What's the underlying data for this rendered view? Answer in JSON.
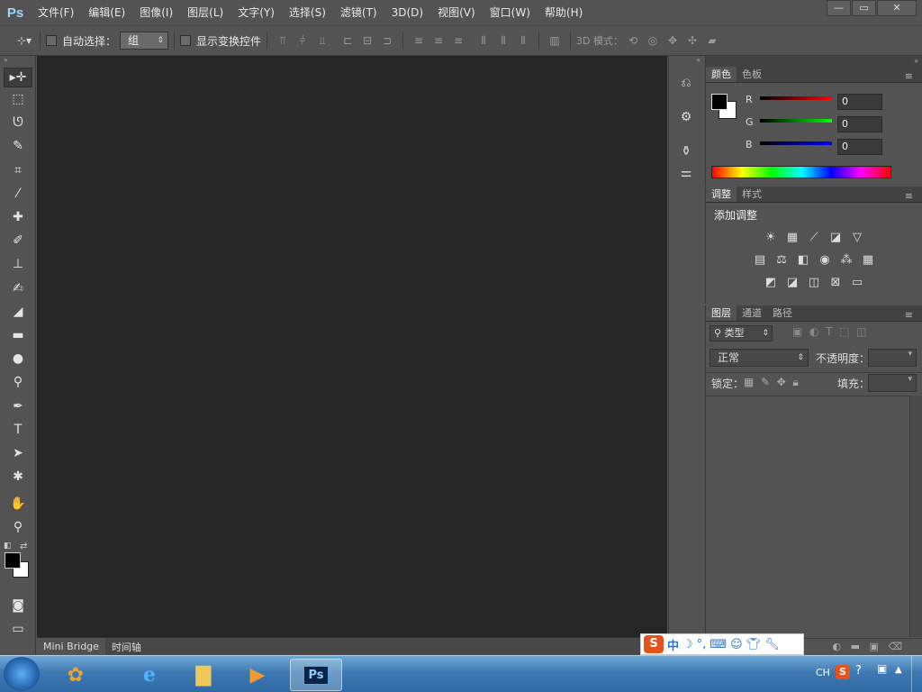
{
  "app": {
    "logo": "Ps"
  },
  "menu": [
    "文件(F)",
    "编辑(E)",
    "图像(I)",
    "图层(L)",
    "文字(Y)",
    "选择(S)",
    "滤镜(T)",
    "3D(D)",
    "视图(V)",
    "窗口(W)",
    "帮助(H)"
  ],
  "window_buttons": {
    "minimize": "—",
    "restore": "▭",
    "close": "✕"
  },
  "options_bar": {
    "auto_select_label": "自动选择：",
    "auto_select_value": "组",
    "show_transform_label": "显示变换控件",
    "mode_3d_label": "3D 模式："
  },
  "tools": [
    "move-tool",
    "marquee-tool",
    "lasso-tool",
    "quick-select-tool",
    "crop-tool",
    "eyedropper-tool",
    "healing-brush-tool",
    "brush-tool",
    "clone-stamp-tool",
    "history-brush-tool",
    "eraser-tool",
    "gradient-tool",
    "blur-tool",
    "dodge-tool",
    "pen-tool",
    "type-tool",
    "path-select-tool",
    "shape-tool",
    "hand-tool",
    "zoom-tool"
  ],
  "color_panel": {
    "tabs": [
      "颜色",
      "色板"
    ],
    "r_label": "R",
    "g_label": "G",
    "b_label": "B",
    "r_value": "0",
    "g_value": "0",
    "b_value": "0",
    "foreground": "#000000",
    "background": "#ffffff"
  },
  "adjust_panel": {
    "tabs": [
      "调整",
      "样式"
    ],
    "title": "添加调整"
  },
  "layers_panel": {
    "tabs": [
      "图层",
      "通道",
      "路径"
    ],
    "filter_kind": "类型",
    "blend_mode": "正常",
    "opacity_label": "不透明度：",
    "lock_label": "锁定：",
    "fill_label": "填充："
  },
  "doc_tabs": [
    "Mini Bridge",
    "时间轴"
  ],
  "ime_bar": {
    "logo": "S",
    "mode": "中"
  },
  "taskbar": {
    "lang": "CH"
  }
}
